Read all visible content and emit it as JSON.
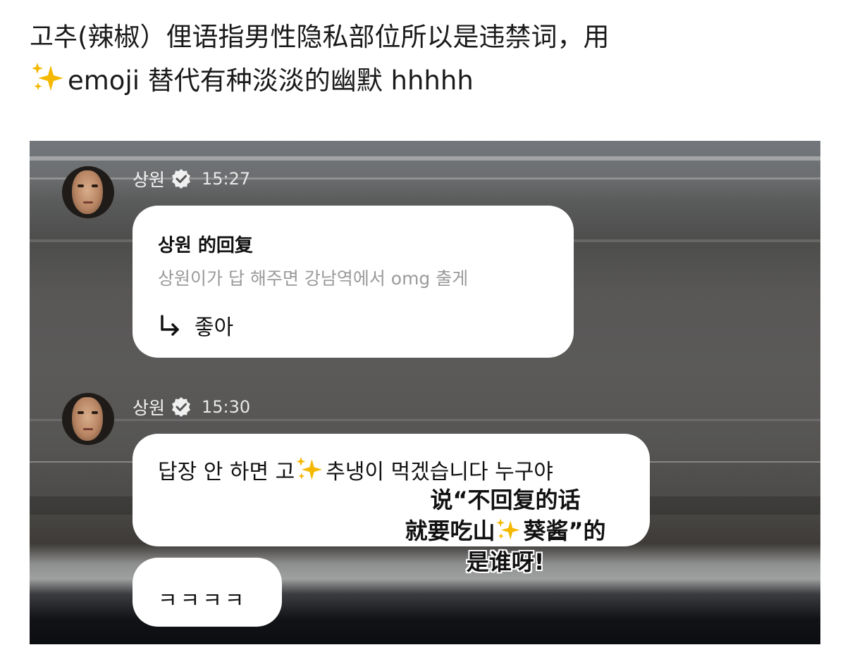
{
  "caption": {
    "line1": "고추(辣椒）俚语指男性隐私部位所以是违禁词，用",
    "line2_text": "emoji 替代有种淡淡的幽默 hhhhh",
    "sparkle_icon": "sparkles-icon"
  },
  "messages": [
    {
      "author": "상원",
      "time": "15:27",
      "reply_title": "상원 的回复",
      "reply_quote": "상원이가 답 해주면 강남역에서 omg 출게",
      "reply_text": "좋아"
    },
    {
      "author": "상원",
      "time": "15:30",
      "text_before": "답장 안 하면 고",
      "text_after": "추냉이 먹겠습니다 누구야",
      "followup": "ㅋㅋㅋㅋ"
    }
  ],
  "overlay": {
    "line1": "说“不回复的话",
    "line2_before": "就要吃山",
    "line2_after": "葵酱”的",
    "line3": "是谁呀!"
  },
  "colors": {
    "bubble": "#ffffff",
    "sparkle_gold": "#f5b800",
    "meta_text": "#f3f3f3"
  }
}
